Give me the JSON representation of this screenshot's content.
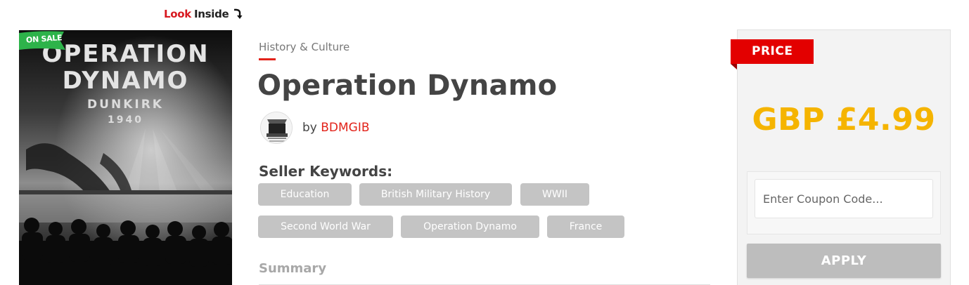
{
  "look_inside": {
    "word1": "Look",
    "word2": "Inside",
    "icon": "curved-arrow-icon"
  },
  "cover": {
    "badge": "ON SALE",
    "title_line1": "OPERATION",
    "title_line2": "DYNAMO",
    "subtitle_line1": "DUNKIRK",
    "subtitle_line2": "1940"
  },
  "product": {
    "category": "History & Culture",
    "title": "Operation Dynamo",
    "by_label": "by",
    "author": "BDMGIB"
  },
  "keywords": {
    "heading": "Seller Keywords:",
    "items": [
      "Education",
      "British Military History",
      "WWII",
      "Second World War",
      "Operation Dynamo",
      "France"
    ]
  },
  "summary": {
    "heading": "Summary"
  },
  "price_panel": {
    "tag": "PRICE",
    "price": "GBP £4.99",
    "coupon_placeholder": "Enter Coupon Code...",
    "apply_label": "APPLY"
  },
  "colors": {
    "accent_red": "#e2231a",
    "price_gold": "#f5b400",
    "badge_green": "#2db34a",
    "keyword_bg": "#c4c4c4",
    "apply_bg": "#bdbdbd"
  }
}
